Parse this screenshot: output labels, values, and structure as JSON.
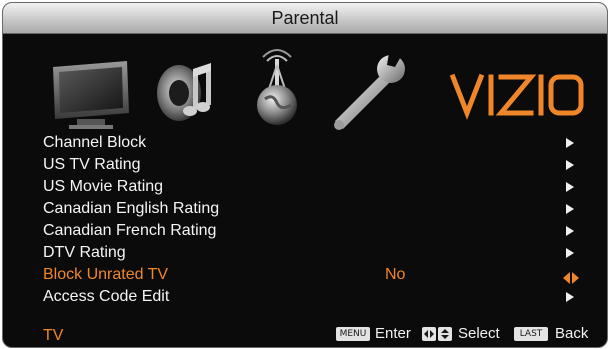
{
  "header": {
    "title": "Parental"
  },
  "icons": {
    "tv": "tv-icon",
    "audio": "audio-speaker-icon",
    "network": "network-globe-icon",
    "settings": "wrench-settings-icon",
    "brand_text": "VIZIO"
  },
  "menu": {
    "items": [
      {
        "label": "Channel Block"
      },
      {
        "label": "US TV Rating"
      },
      {
        "label": "US Movie Rating"
      },
      {
        "label": "Canadian English Rating"
      },
      {
        "label": "Canadian French Rating"
      },
      {
        "label": "DTV Rating"
      },
      {
        "label": "Block Unrated TV",
        "value": "No"
      },
      {
        "label": "Access Code Edit"
      }
    ]
  },
  "footer": {
    "source": "TV",
    "menu_key": "MENU",
    "enter_label": "Enter",
    "select_label": "Select",
    "last_key": "LAST",
    "back_label": "Back"
  },
  "colors": {
    "accent": "#f0862a",
    "background": "#0b0b0b",
    "text": "#f5f5f5"
  }
}
